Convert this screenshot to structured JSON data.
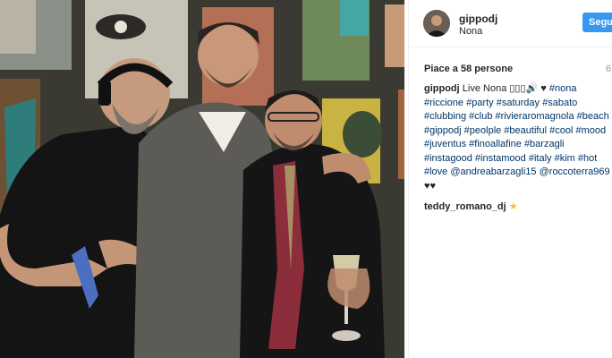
{
  "post": {
    "photo_alt": "Four men posing together in a club",
    "colors": {
      "accent": "#3897f0",
      "link": "#003569",
      "text": "#262626",
      "muted": "#999999"
    }
  },
  "header": {
    "username": "gippodj",
    "location": "Nona",
    "follow_label": "Segui"
  },
  "likes": {
    "text": "Piace a 58 persone"
  },
  "time": {
    "text": "6"
  },
  "caption": {
    "username": "gippodj",
    "text_start": " Live Nona ",
    "emoji": "▯▯▯🔊",
    "heart": " ♥ ",
    "lines": [
      [
        "#nona"
      ],
      [
        "#riccione",
        " ",
        "#party",
        " ",
        "#saturday",
        " ",
        "#sabato"
      ],
      [
        "#clubbing",
        " ",
        "#club",
        " ",
        "#rivieraromagnola",
        " ",
        "#beach"
      ],
      [
        "#gippodj",
        " ",
        "#peolple",
        " ",
        "#beautiful",
        " ",
        "#cool",
        " ",
        "#mood"
      ],
      [
        "#juventus",
        " ",
        "#finoallafine",
        " ",
        "#barzagli"
      ],
      [
        "#instagood",
        " ",
        "#instamood",
        " ",
        "#italy",
        " ",
        "#kim",
        " ",
        "#hot"
      ],
      [
        "#love",
        " ",
        "@andreabarzagli15",
        " ",
        "@roccoterra969"
      ]
    ],
    "hearts": "♥♥"
  },
  "comment": {
    "username": "teddy_romano_dj",
    "text": " ★"
  }
}
